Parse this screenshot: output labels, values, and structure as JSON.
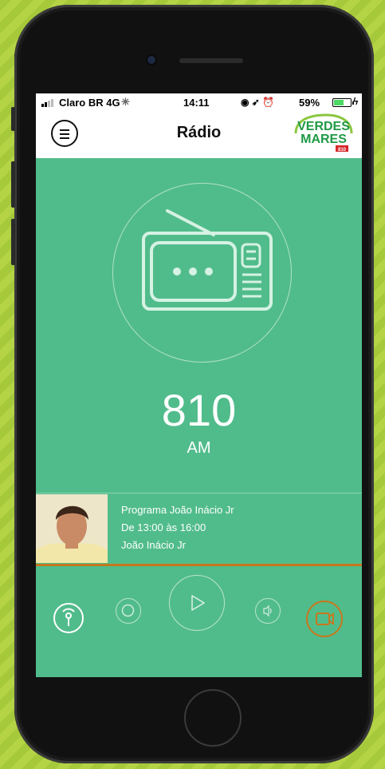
{
  "status_bar": {
    "carrier": "Claro BR",
    "network": "4G",
    "time": "14:11",
    "battery": "59%",
    "battery_level": 0.59
  },
  "header": {
    "title": "Rádio",
    "logo": {
      "line1": "VERDES",
      "line2": "MARES",
      "line3": "810"
    }
  },
  "station": {
    "frequency": "810",
    "band": "AM"
  },
  "program": {
    "name": "Programa João Inácio Jr",
    "schedule": "De 13:00 às 16:00",
    "host": "João Inácio Jr"
  },
  "colors": {
    "screen_bg": "#51bc8b",
    "accent_orange": "#c6781e"
  },
  "controls": [
    {
      "name": "live-broadcast-icon"
    },
    {
      "name": "record-icon"
    },
    {
      "name": "play-icon"
    },
    {
      "name": "volume-icon"
    },
    {
      "name": "camera-icon"
    }
  ]
}
